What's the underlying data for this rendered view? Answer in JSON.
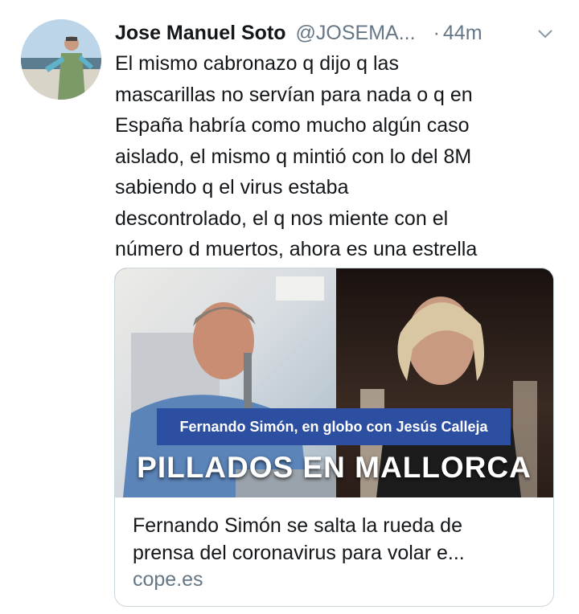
{
  "tweet": {
    "author_name": "Jose Manuel Soto",
    "handle": "@JOSEMA...",
    "separator": "·",
    "time": "44m",
    "text_lines": [
      "El mismo cabronazo q dijo q las",
      "mascarillas no servían para nada o q en",
      "España habría como mucho algún caso",
      "aislado, el mismo q mintió con lo del 8M",
      "sabiendo q el virus estaba",
      "descontrolado, el q nos miente con el",
      "número d muertos, ahora es una estrella"
    ],
    "more_icon": "chevron-down-icon"
  },
  "card": {
    "image_subtitle": "Fernando Simón, en globo con Jesús Calleja",
    "image_headline": "PILLADOS EN MALLORCA",
    "title_lines": [
      "Fernando Simón se salta la rueda de",
      "prensa del coronavirus para volar e..."
    ],
    "domain": "cope.es"
  },
  "colors": {
    "text": "#14171a",
    "secondary": "#657786",
    "border": "#ccd6dd",
    "band": "#2c4fa1"
  }
}
